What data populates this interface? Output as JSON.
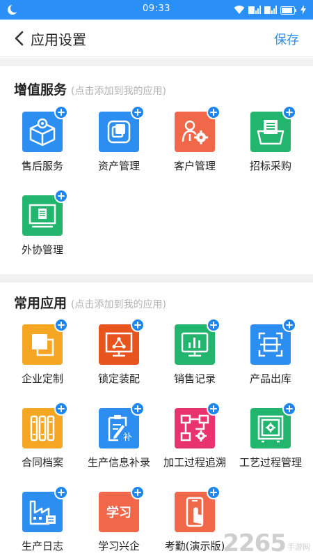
{
  "status_bar": {
    "time": "09:33"
  },
  "header": {
    "back_icon": "chevron-left-icon",
    "title": "应用设置",
    "save_label": "保存"
  },
  "colors": {
    "accent": "#2a8ff7",
    "add_badge": "#1e86f0"
  },
  "value_added": {
    "title": "增值服务",
    "hint": "(点击添加到我的应用)",
    "apps": [
      {
        "label": "售后服务",
        "icon": "package-gear-icon",
        "color": "#2b8ef0"
      },
      {
        "label": "资产管理",
        "icon": "layers-icon",
        "color": "#2b8ef0"
      },
      {
        "label": "客户管理",
        "icon": "user-gear-icon",
        "color": "#f0674a"
      },
      {
        "label": "招标采购",
        "icon": "shopping-basket-icon",
        "color": "#22b56e"
      },
      {
        "label": "外协管理",
        "icon": "monitor-document-icon",
        "color": "#22b56e"
      }
    ]
  },
  "common": {
    "title": "常用应用",
    "hint": "(点击添加到我的应用)",
    "apps": [
      {
        "label": "企业定制",
        "icon": "overlap-squares-icon",
        "color": "#f5a623"
      },
      {
        "label": "锁定装配",
        "icon": "monitor-nodes-icon",
        "color": "#e8541e"
      },
      {
        "label": "销售记录",
        "icon": "monitor-chart-icon",
        "color": "#22b56e"
      },
      {
        "label": "产品出库",
        "icon": "scan-frame-icon",
        "color": "#2b8ef0"
      },
      {
        "label": "合同档案",
        "icon": "filing-cabinet-icon",
        "color": "#f5a623"
      },
      {
        "label": "生产信息补录",
        "icon": "clipboard-edit-icon",
        "color": "#2b8ef0"
      },
      {
        "label": "加工过程追溯",
        "icon": "flowchart-gear-icon",
        "color": "#e8336e"
      },
      {
        "label": "工艺过程管理",
        "icon": "safe-gear-icon",
        "color": "#22b56e"
      },
      {
        "label": "生产日志",
        "icon": "factory-icon",
        "color": "#2b8ef0"
      },
      {
        "label": "学习兴企",
        "icon": "study-text-icon",
        "color": "#f0674a",
        "icon_text": "学习"
      },
      {
        "label": "考勤(演示版)",
        "icon": "phone-touch-icon",
        "color": "#f0674a"
      }
    ]
  },
  "watermark": {
    "brand": "2265",
    "suffix": ".com",
    "site": "手游网"
  }
}
